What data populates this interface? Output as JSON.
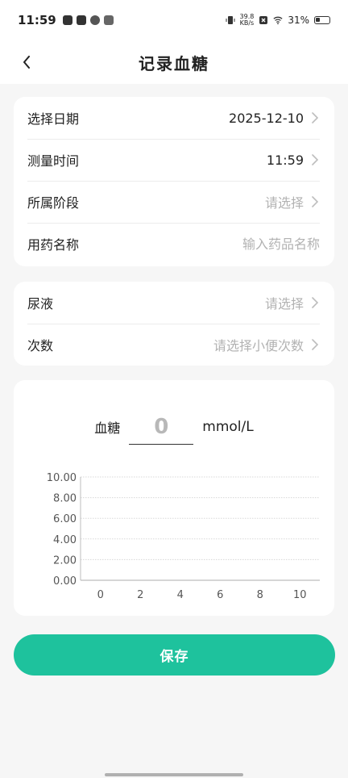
{
  "status_bar": {
    "time": "11:59",
    "network_speed_value": "39.8",
    "network_speed_unit": "KB/s",
    "battery": "31%"
  },
  "nav": {
    "title": "记录血糖"
  },
  "form": {
    "date": {
      "label": "选择日期",
      "value": "2025-12-10"
    },
    "time": {
      "label": "测量时间",
      "value": "11:59"
    },
    "stage": {
      "label": "所属阶段",
      "placeholder": "请选择"
    },
    "medicine": {
      "label": "用药名称",
      "placeholder": "输入药品名称"
    }
  },
  "urine": {
    "urine": {
      "label": "尿液",
      "placeholder": "请选择"
    },
    "count": {
      "label": "次数",
      "placeholder": "请选择小便次数"
    }
  },
  "glucose": {
    "label": "血糖",
    "value": "0",
    "unit": "mmol/L"
  },
  "chart_data": {
    "type": "line",
    "x_ticks": [
      "0",
      "2",
      "4",
      "6",
      "8",
      "10"
    ],
    "y_ticks": [
      "0.00",
      "2.00",
      "4.00",
      "6.00",
      "8.00",
      "10.00"
    ],
    "xlim": [
      -1,
      11
    ],
    "ylim": [
      0,
      10
    ],
    "series": [],
    "grid": true,
    "grid_style": "dotted",
    "colors": {
      "grid": "#d8d8d8",
      "axis": "#bdbdbd",
      "tick_text": "#555555"
    }
  },
  "actions": {
    "save_label": "保存"
  },
  "colors": {
    "accent": "#1ec29d",
    "background": "#f6f6f6",
    "placeholder": "#b2b2b2"
  }
}
